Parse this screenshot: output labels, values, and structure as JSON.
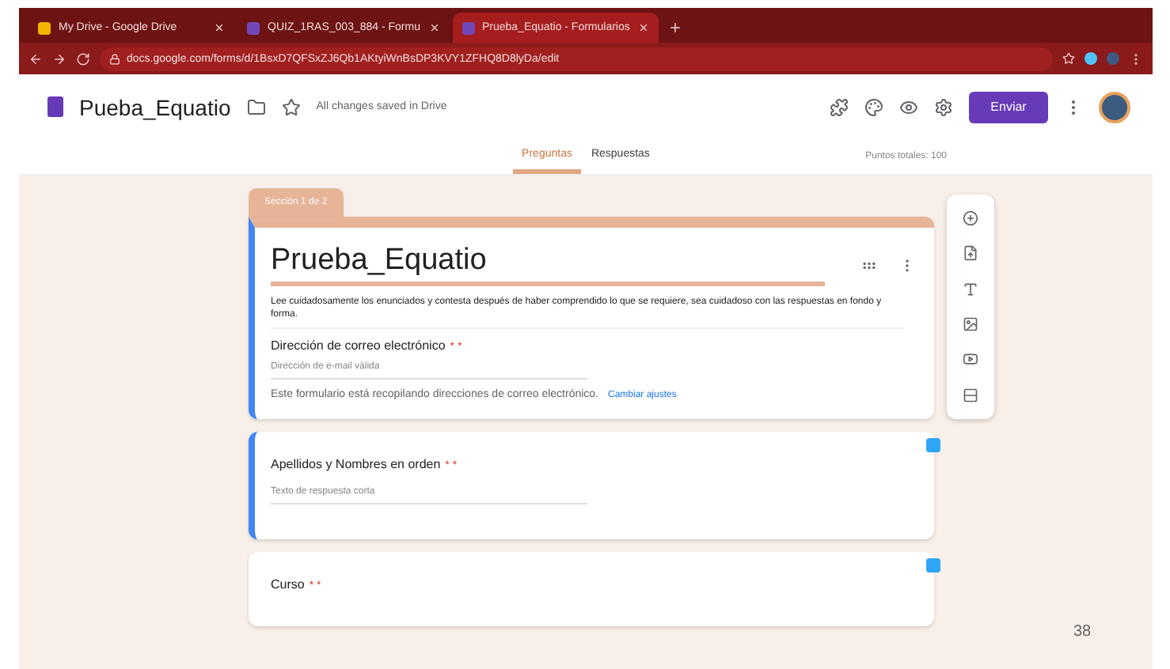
{
  "browser": {
    "tabs": [
      {
        "title": "My Drive - Google Drive",
        "kind": "drive",
        "selected": false
      },
      {
        "title": "QUIZ_1RAS_003_884 - Formu",
        "kind": "forms",
        "selected": false
      },
      {
        "title": "Prueba_Equatio - Formularios",
        "kind": "forms",
        "selected": true
      }
    ],
    "url": "docs.google.com/forms/d/1BsxD7QFSxZJ6Qb1AKtyiWnBsDP3KVY1ZFHQ8D8lyDa/edit"
  },
  "header": {
    "doc_title": "Pueba_Equatio",
    "save_status": "All changes saved in Drive",
    "send_button": "Enviar"
  },
  "form_tabs": [
    {
      "label": "Preguntas",
      "selected": true
    },
    {
      "label": "Respuestas",
      "selected": false
    }
  ],
  "total_points": "Puntos totales: 100",
  "section_label": "Sección 1 de 2",
  "form": {
    "title": "Prueba_Equatio",
    "description": "Lee cuidadosamente los enunciados y contesta después de haber comprendido lo que se requiere, sea cuidadoso con las respuestas en fondo y forma.",
    "email_question": {
      "label": "Dirección de correo electrónico",
      "required_mark": "* *",
      "placeholder": "Dirección de e-mail válida"
    },
    "notice": "Este formulario está recopilando direcciones de correo electrónico.",
    "notice_link": "Cambiar ajustes"
  },
  "questions": [
    {
      "label": "Apellidos y Nombres en orden",
      "required_mark": "* *",
      "placeholder": "Texto de respuesta corta",
      "selected": true
    },
    {
      "label": "Curso",
      "required_mark": "* *",
      "selected": false
    }
  ],
  "slide_number": "38"
}
